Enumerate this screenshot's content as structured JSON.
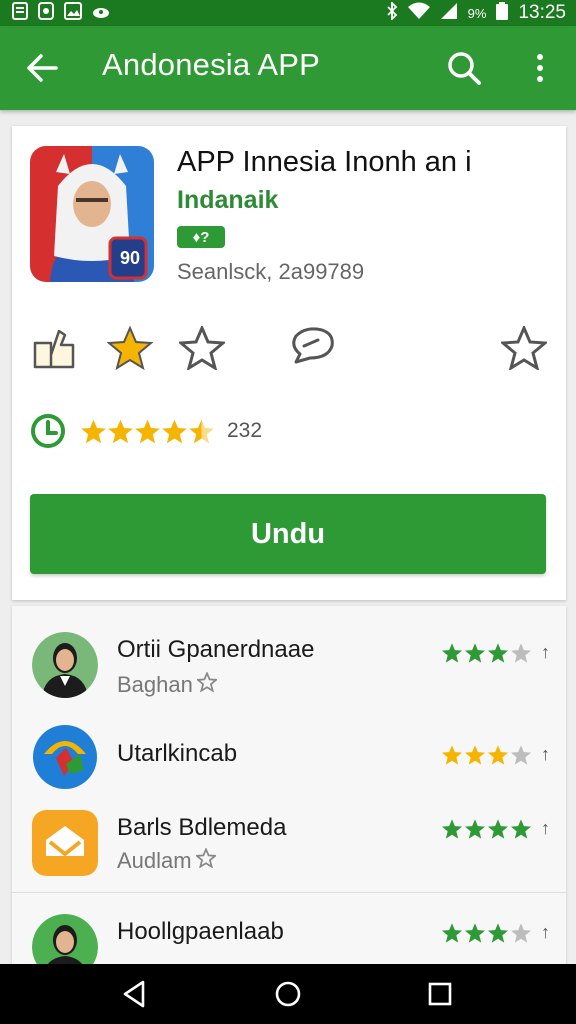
{
  "status_bar": {
    "time": "13:25",
    "battery": "9%",
    "icons": [
      "document-icon",
      "settings-icon",
      "image-icon",
      "cloud-icon",
      "bluetooth-icon",
      "wifi-icon",
      "signal-icon",
      "battery-icon"
    ]
  },
  "appbar": {
    "title": "Andonesia APP",
    "color": "#2f9a35",
    "icons": [
      "back-arrow-icon",
      "search-icon",
      "more-vert-icon"
    ]
  },
  "app": {
    "name": "APP Innesia Inonh an i",
    "developer": "Indanaik",
    "badge": "♦?",
    "meta": "Seanlsck, 2a99789",
    "icon_number": "90",
    "rating_value": 4.5,
    "rating_count": "232",
    "install_label": "Undu",
    "accent_color": "#2e9a35"
  },
  "actions": [
    "share-icon",
    "star-filled-icon",
    "star-outline-icon",
    "comment-icon",
    "star-outline-icon"
  ],
  "list": {
    "items": [
      {
        "title": "Ortii Gpanerdnaae",
        "subtitle": "Baghan",
        "stars": 3,
        "star_color": "#2e9a35",
        "icon": "portrait-icon"
      },
      {
        "title": "Utarlkincab",
        "subtitle": "",
        "stars": 3,
        "star_color": "#f4b400",
        "icon": "colorful-logo-icon"
      },
      {
        "title": "Barls Bdlemeda",
        "subtitle": "Audlam",
        "stars": 4,
        "star_color": "#2e9a35",
        "icon": "orange-app-icon"
      },
      {
        "title": "Hoollgpaenlaab",
        "subtitle": "",
        "stars": 3,
        "star_color": "#2e9a35",
        "icon": "portrait-icon"
      }
    ]
  },
  "navbar": {
    "icons": [
      "back-triangle-icon",
      "home-circle-icon",
      "recents-square-icon"
    ]
  }
}
